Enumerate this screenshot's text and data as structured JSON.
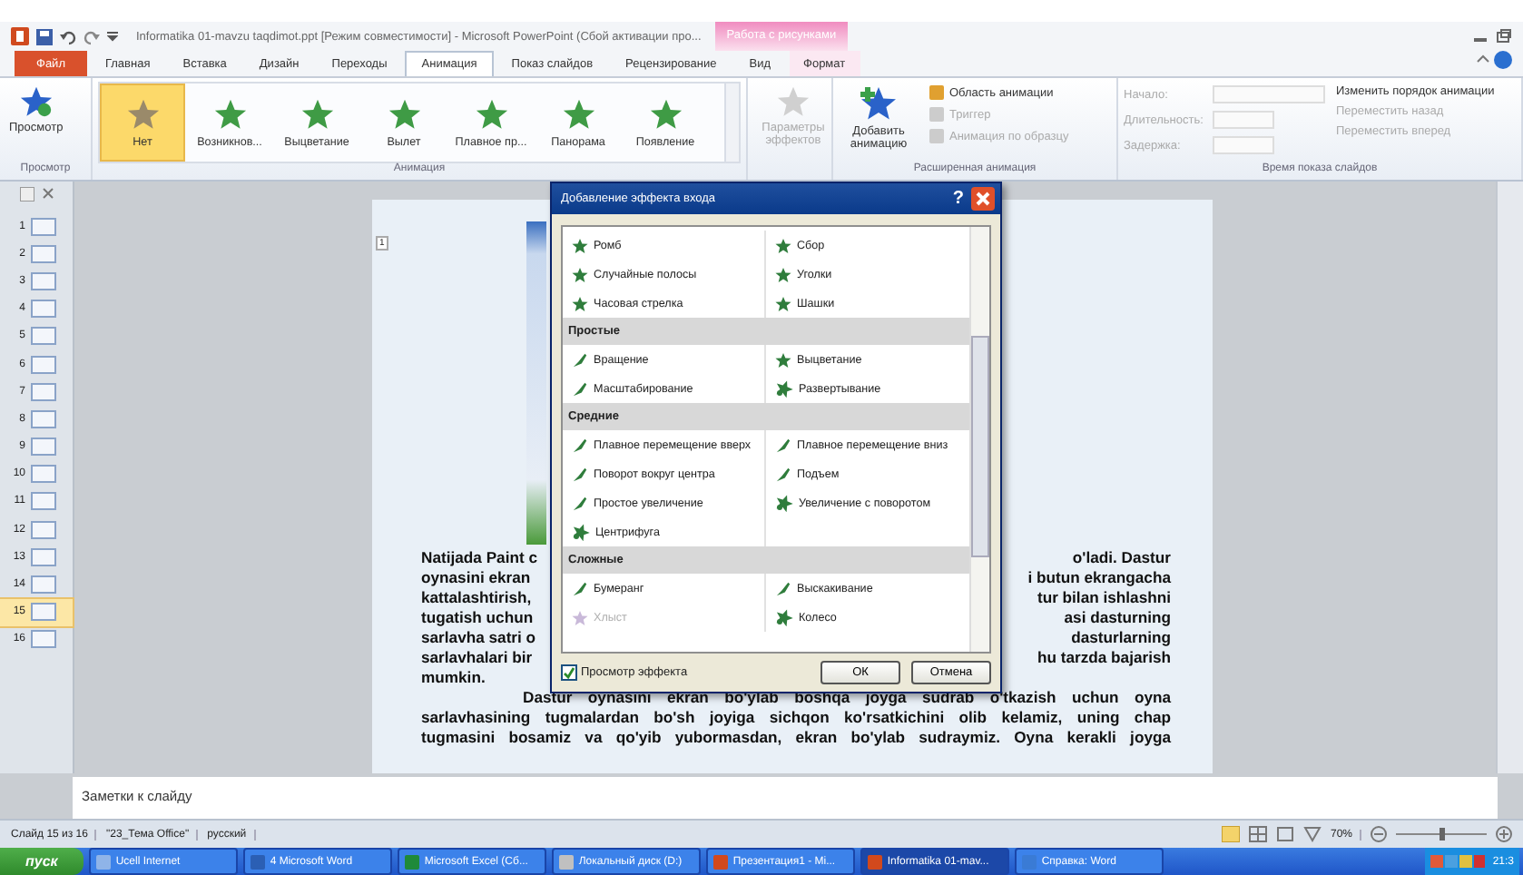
{
  "window": {
    "title": "Informatika 01-mavzu taqdimot.ppt [Режим совместимости] - Microsoft PowerPoint (Сбой активации про...",
    "context_tab": "Работа с рисунками"
  },
  "tabs": [
    {
      "label": "Файл",
      "selected": false,
      "kind": "file"
    },
    {
      "label": "Главная",
      "selected": false,
      "kind": "normal"
    },
    {
      "label": "Вставка",
      "selected": false,
      "kind": "normal"
    },
    {
      "label": "Дизайн",
      "selected": false,
      "kind": "normal"
    },
    {
      "label": "Переходы",
      "selected": false,
      "kind": "normal"
    },
    {
      "label": "Анимация",
      "selected": true,
      "kind": "normal"
    },
    {
      "label": "Показ слайдов",
      "selected": false,
      "kind": "normal"
    },
    {
      "label": "Рецензирование",
      "selected": false,
      "kind": "normal"
    },
    {
      "label": "Вид",
      "selected": false,
      "kind": "normal"
    },
    {
      "label": "Формат",
      "selected": false,
      "kind": "context"
    }
  ],
  "ribbon": {
    "preview": {
      "button": "Просмотр",
      "group": "Просмотр"
    },
    "gallery": {
      "group": "Анимация",
      "items": [
        {
          "label": "Нет",
          "selected": true,
          "kind": "none"
        },
        {
          "label": "Возникнов...",
          "selected": false,
          "kind": "effect"
        },
        {
          "label": "Выцветание",
          "selected": false,
          "kind": "effect"
        },
        {
          "label": "Вылет",
          "selected": false,
          "kind": "effect"
        },
        {
          "label": "Плавное пр...",
          "selected": false,
          "kind": "effect"
        },
        {
          "label": "Панорама",
          "selected": false,
          "kind": "effect"
        },
        {
          "label": "Появление",
          "selected": false,
          "kind": "effect"
        }
      ]
    },
    "effect_options": {
      "label": "Параметры эффектов",
      "disabled": true
    },
    "advanced": {
      "group": "Расширенная анимация",
      "add": "Добавить анимацию",
      "commands": [
        {
          "label": "Область анимации",
          "disabled": false
        },
        {
          "label": "Триггер",
          "disabled": true
        },
        {
          "label": "Анимация по образцу",
          "disabled": true
        }
      ]
    },
    "timing": {
      "group": "Время показа слайдов",
      "fields": [
        {
          "label": "Начало:",
          "disabled": true,
          "kind": "dropdown"
        },
        {
          "label": "Длительность:",
          "disabled": true,
          "kind": "spinner"
        },
        {
          "label": "Задержка:",
          "disabled": true,
          "kind": "spinner"
        }
      ],
      "reorder": {
        "title": "Изменить порядок анимации",
        "commands": [
          {
            "label": "Переместить назад",
            "disabled": true
          },
          {
            "label": "Переместить вперед",
            "disabled": true
          }
        ]
      }
    }
  },
  "slides": [
    {
      "number": "1",
      "selected": false
    },
    {
      "number": "2",
      "selected": false
    },
    {
      "number": "3",
      "selected": false
    },
    {
      "number": "4",
      "selected": false
    },
    {
      "number": "5",
      "selected": false
    },
    {
      "number": "6",
      "selected": false
    },
    {
      "number": "7",
      "selected": false
    },
    {
      "number": "8",
      "selected": false
    },
    {
      "number": "9",
      "selected": false
    },
    {
      "number": "10",
      "selected": false
    },
    {
      "number": "11",
      "selected": false
    },
    {
      "number": "12",
      "selected": false
    },
    {
      "number": "13",
      "selected": false
    },
    {
      "number": "14",
      "selected": false
    },
    {
      "number": "15",
      "selected": true
    },
    {
      "number": "16",
      "selected": false
    }
  ],
  "slide": {
    "marker": "1",
    "split_lines": [
      {
        "left": "Natijada Paint c",
        "right": "o'ladi. Dastur"
      },
      {
        "left": "oynasini ekran",
        "right": "i butun ekrangacha"
      },
      {
        "left": "kattalashtirish,",
        "right": "tur bilan ishlashni"
      },
      {
        "left": "tugatish uchun",
        "right": "asi dasturning"
      },
      {
        "left": "sarlavha satri o",
        "right": "dasturlarning"
      },
      {
        "left": "sarlavhalari bir",
        "right": "hu tarzda bajarish"
      }
    ],
    "last_line": "mumkin.",
    "paragraph": [
      "Dastur oynasini ekran bo'ylab boshqa joyga sudrab o'tkazish uchun oyna",
      "sarlavhasining tugmalardan bo'sh joyiga sichqon ko'rsatkichini olib kelamiz, uning chap",
      "tugmasini bosamiz va qo'yib yubormasdan, ekran bo'ylab sudraymiz. Oyna kerakli joyga"
    ]
  },
  "dialog": {
    "title": "Добавление эффекта входа",
    "help": "?",
    "sections": [
      {
        "items": [
          {
            "label": "Ромб",
            "kind": "star",
            "disabled": false
          },
          {
            "label": "Сбор",
            "kind": "star",
            "disabled": false
          },
          {
            "label": "Случайные полосы",
            "kind": "star",
            "disabled": false
          },
          {
            "label": "Уголки",
            "kind": "star",
            "disabled": false
          },
          {
            "label": "Часовая стрелка",
            "kind": "star",
            "disabled": false
          },
          {
            "label": "Шашки",
            "kind": "star",
            "disabled": false
          }
        ]
      },
      {
        "title": "Простые",
        "items": [
          {
            "label": "Вращение",
            "kind": "stroke",
            "disabled": false
          },
          {
            "label": "Выцветание",
            "kind": "star",
            "disabled": false
          },
          {
            "label": "Масштабирование",
            "kind": "stroke",
            "disabled": false
          },
          {
            "label": "Развертывание",
            "kind": "burst",
            "disabled": false
          }
        ]
      },
      {
        "title": "Средние",
        "items": [
          {
            "label": "Плавное перемещение вверх",
            "kind": "stroke",
            "disabled": false
          },
          {
            "label": "Плавное перемещение вниз",
            "kind": "stroke",
            "disabled": false
          },
          {
            "label": "Поворот вокруг центра",
            "kind": "stroke",
            "disabled": false
          },
          {
            "label": "Подъем",
            "kind": "stroke",
            "disabled": false
          },
          {
            "label": "Простое увеличение",
            "kind": "stroke",
            "disabled": false
          },
          {
            "label": "Увеличение с поворотом",
            "kind": "burst",
            "disabled": false
          },
          {
            "label": "Центрифуга",
            "kind": "burst",
            "disabled": false
          }
        ]
      },
      {
        "title": "Сложные",
        "items": [
          {
            "label": "Бумеранг",
            "kind": "stroke",
            "disabled": false
          },
          {
            "label": "Выскакивание",
            "kind": "stroke",
            "disabled": false
          },
          {
            "label": "Хлыст",
            "kind": "star",
            "disabled": true
          },
          {
            "label": "Колесо",
            "kind": "burst",
            "disabled": false
          }
        ]
      }
    ],
    "preview": {
      "label": "Просмотр эффекта",
      "checked": true
    },
    "buttons": [
      "ОК",
      "Отмена"
    ]
  },
  "notes": {
    "placeholder": "Заметки к слайду"
  },
  "status_bar": {
    "items": [
      "Слайд 15 из 16",
      "\"23_Тема Office\"",
      "русский"
    ],
    "zoom": "70%",
    "zoom_slider": {
      "level": 0.5
    }
  },
  "taskbar": {
    "start": "пуск",
    "items": [
      {
        "label": "Ucell Internet",
        "selected": false,
        "kind": "globe"
      },
      {
        "label": "4 Microsoft Word",
        "selected": false,
        "kind": "word"
      },
      {
        "label": "Microsoft Excel (Сб...",
        "selected": false,
        "kind": "excel"
      },
      {
        "label": "Локальный диск (D:)",
        "selected": false,
        "kind": "drive"
      },
      {
        "label": "Презентация1 - Mi...",
        "selected": false,
        "kind": "ppt"
      },
      {
        "label": "Informatika 01-mav...",
        "selected": true,
        "kind": "ppt"
      },
      {
        "label": "Справка: Word",
        "selected": false,
        "kind": "help"
      }
    ],
    "clock": "21:3"
  }
}
